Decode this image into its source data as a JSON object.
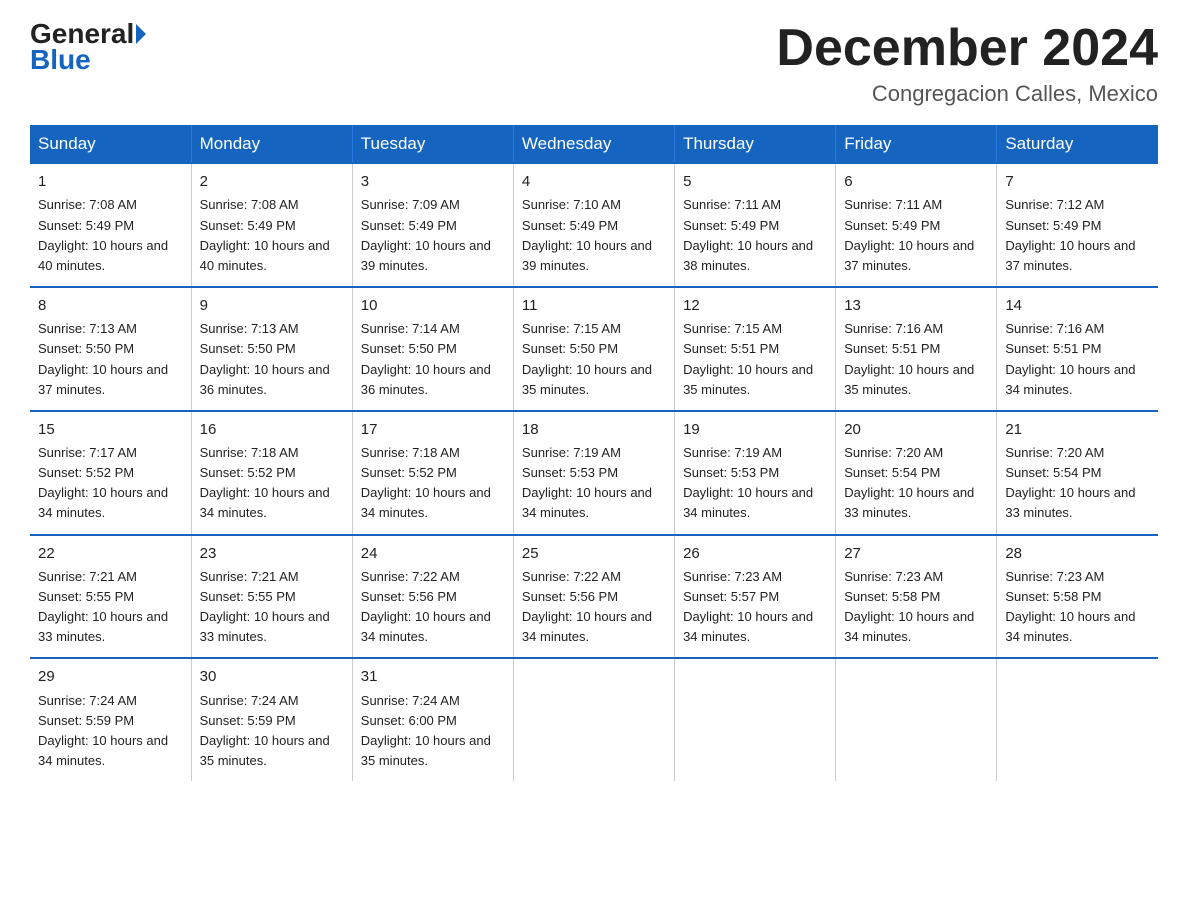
{
  "logo": {
    "general": "General",
    "blue": "Blue",
    "arrow": "▶"
  },
  "title": "December 2024",
  "location": "Congregacion Calles, Mexico",
  "days_of_week": [
    "Sunday",
    "Monday",
    "Tuesday",
    "Wednesday",
    "Thursday",
    "Friday",
    "Saturday"
  ],
  "weeks": [
    [
      {
        "day": "1",
        "sunrise": "7:08 AM",
        "sunset": "5:49 PM",
        "daylight": "10 hours and 40 minutes."
      },
      {
        "day": "2",
        "sunrise": "7:08 AM",
        "sunset": "5:49 PM",
        "daylight": "10 hours and 40 minutes."
      },
      {
        "day": "3",
        "sunrise": "7:09 AM",
        "sunset": "5:49 PM",
        "daylight": "10 hours and 39 minutes."
      },
      {
        "day": "4",
        "sunrise": "7:10 AM",
        "sunset": "5:49 PM",
        "daylight": "10 hours and 39 minutes."
      },
      {
        "day": "5",
        "sunrise": "7:11 AM",
        "sunset": "5:49 PM",
        "daylight": "10 hours and 38 minutes."
      },
      {
        "day": "6",
        "sunrise": "7:11 AM",
        "sunset": "5:49 PM",
        "daylight": "10 hours and 37 minutes."
      },
      {
        "day": "7",
        "sunrise": "7:12 AM",
        "sunset": "5:49 PM",
        "daylight": "10 hours and 37 minutes."
      }
    ],
    [
      {
        "day": "8",
        "sunrise": "7:13 AM",
        "sunset": "5:50 PM",
        "daylight": "10 hours and 37 minutes."
      },
      {
        "day": "9",
        "sunrise": "7:13 AM",
        "sunset": "5:50 PM",
        "daylight": "10 hours and 36 minutes."
      },
      {
        "day": "10",
        "sunrise": "7:14 AM",
        "sunset": "5:50 PM",
        "daylight": "10 hours and 36 minutes."
      },
      {
        "day": "11",
        "sunrise": "7:15 AM",
        "sunset": "5:50 PM",
        "daylight": "10 hours and 35 minutes."
      },
      {
        "day": "12",
        "sunrise": "7:15 AM",
        "sunset": "5:51 PM",
        "daylight": "10 hours and 35 minutes."
      },
      {
        "day": "13",
        "sunrise": "7:16 AM",
        "sunset": "5:51 PM",
        "daylight": "10 hours and 35 minutes."
      },
      {
        "day": "14",
        "sunrise": "7:16 AM",
        "sunset": "5:51 PM",
        "daylight": "10 hours and 34 minutes."
      }
    ],
    [
      {
        "day": "15",
        "sunrise": "7:17 AM",
        "sunset": "5:52 PM",
        "daylight": "10 hours and 34 minutes."
      },
      {
        "day": "16",
        "sunrise": "7:18 AM",
        "sunset": "5:52 PM",
        "daylight": "10 hours and 34 minutes."
      },
      {
        "day": "17",
        "sunrise": "7:18 AM",
        "sunset": "5:52 PM",
        "daylight": "10 hours and 34 minutes."
      },
      {
        "day": "18",
        "sunrise": "7:19 AM",
        "sunset": "5:53 PM",
        "daylight": "10 hours and 34 minutes."
      },
      {
        "day": "19",
        "sunrise": "7:19 AM",
        "sunset": "5:53 PM",
        "daylight": "10 hours and 34 minutes."
      },
      {
        "day": "20",
        "sunrise": "7:20 AM",
        "sunset": "5:54 PM",
        "daylight": "10 hours and 33 minutes."
      },
      {
        "day": "21",
        "sunrise": "7:20 AM",
        "sunset": "5:54 PM",
        "daylight": "10 hours and 33 minutes."
      }
    ],
    [
      {
        "day": "22",
        "sunrise": "7:21 AM",
        "sunset": "5:55 PM",
        "daylight": "10 hours and 33 minutes."
      },
      {
        "day": "23",
        "sunrise": "7:21 AM",
        "sunset": "5:55 PM",
        "daylight": "10 hours and 33 minutes."
      },
      {
        "day": "24",
        "sunrise": "7:22 AM",
        "sunset": "5:56 PM",
        "daylight": "10 hours and 34 minutes."
      },
      {
        "day": "25",
        "sunrise": "7:22 AM",
        "sunset": "5:56 PM",
        "daylight": "10 hours and 34 minutes."
      },
      {
        "day": "26",
        "sunrise": "7:23 AM",
        "sunset": "5:57 PM",
        "daylight": "10 hours and 34 minutes."
      },
      {
        "day": "27",
        "sunrise": "7:23 AM",
        "sunset": "5:58 PM",
        "daylight": "10 hours and 34 minutes."
      },
      {
        "day": "28",
        "sunrise": "7:23 AM",
        "sunset": "5:58 PM",
        "daylight": "10 hours and 34 minutes."
      }
    ],
    [
      {
        "day": "29",
        "sunrise": "7:24 AM",
        "sunset": "5:59 PM",
        "daylight": "10 hours and 34 minutes."
      },
      {
        "day": "30",
        "sunrise": "7:24 AM",
        "sunset": "5:59 PM",
        "daylight": "10 hours and 35 minutes."
      },
      {
        "day": "31",
        "sunrise": "7:24 AM",
        "sunset": "6:00 PM",
        "daylight": "10 hours and 35 minutes."
      },
      null,
      null,
      null,
      null
    ]
  ],
  "labels": {
    "sunrise": "Sunrise:",
    "sunset": "Sunset:",
    "daylight": "Daylight:"
  }
}
